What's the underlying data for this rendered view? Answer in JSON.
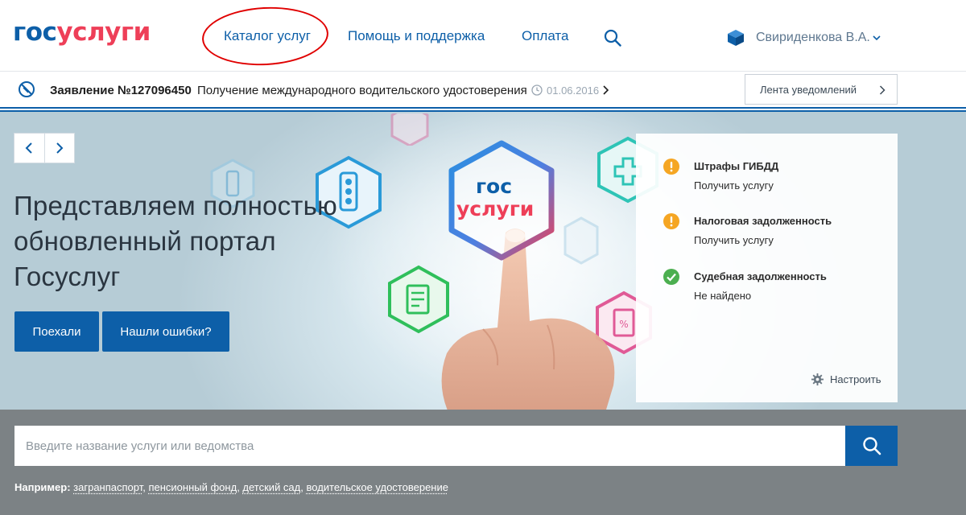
{
  "header": {
    "logo_part1": "гос",
    "logo_part2": "услуги",
    "nav": [
      {
        "label": "Каталог услуг"
      },
      {
        "label": "Помощь и поддержка"
      },
      {
        "label": "Оплата"
      }
    ],
    "user_name": "Свириденкова В.А."
  },
  "application": {
    "number": "Заявление №127096450",
    "description": "Получение международного водительского удостоверения",
    "date": "01.06.2016",
    "feed_button": "Лента уведомлений"
  },
  "hero": {
    "logo_part1": "гос",
    "logo_part2": "услуги",
    "title": "Представляем полностью обновленный портал Госуслуг",
    "primary_button": "Поехали",
    "secondary_button": "Нашли ошибки?"
  },
  "panel": {
    "items": [
      {
        "title": "Штрафы ГИБДД",
        "subtitle": "Получить услугу",
        "status": "warning"
      },
      {
        "title": "Налоговая задолженность",
        "subtitle": "Получить услугу",
        "status": "warning"
      },
      {
        "title": "Судебная задолженность",
        "subtitle": "Не найдено",
        "status": "ok"
      }
    ],
    "settings_label": "Настроить"
  },
  "search": {
    "placeholder": "Введите название услуги или ведомства",
    "examples_label": "Например:",
    "examples": [
      "загранпаспорт",
      "пенсионный фонд",
      "детский сад",
      "водительское удостоверение"
    ]
  },
  "colors": {
    "brand_blue": "#0d5fa8",
    "brand_red": "#ee3f58",
    "warning": "#f5a623",
    "ok": "#4caf50",
    "annotation": "#e00000"
  }
}
